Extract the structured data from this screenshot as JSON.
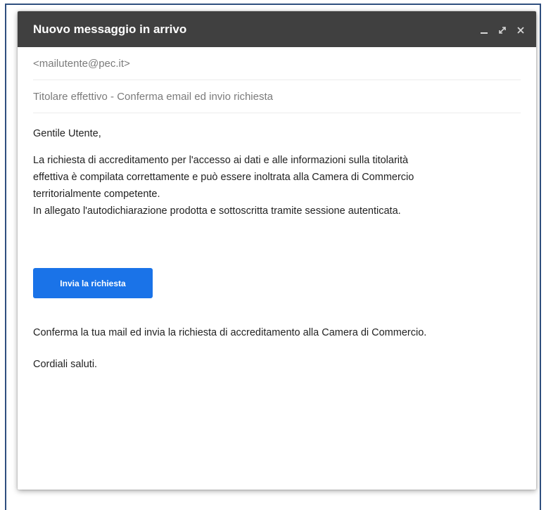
{
  "window": {
    "title": "Nuovo messaggio in arrivo",
    "controls": [
      "minimize-icon",
      "expand-icon",
      "close-icon"
    ]
  },
  "fields": {
    "from": "<mailutente@pec.it>",
    "subject": "Titolare effettivo - Conferma email ed invio richiesta"
  },
  "body": {
    "greeting": "Gentile Utente,",
    "paragraph_lines": [
      "La richiesta di accreditamento per l'accesso ai dati e alle informazioni sulla titolarità",
      "effettiva è compilata correttamente e può essere inoltrata alla Camera di Commercio",
      "territorialmente competente.",
      "In allegato l'autodichiarazione prodotta e sottoscritta tramite sessione autenticata."
    ],
    "button_label": "Invia la richiesta",
    "confirm_text": "Conferma la tua mail ed invia la richiesta di accreditamento alla Camera di Commercio.",
    "closing": "Cordiali saluti."
  },
  "colors": {
    "titlebar": "#404040",
    "button": "#1a73e8",
    "frame_border": "#2f4f7f"
  }
}
